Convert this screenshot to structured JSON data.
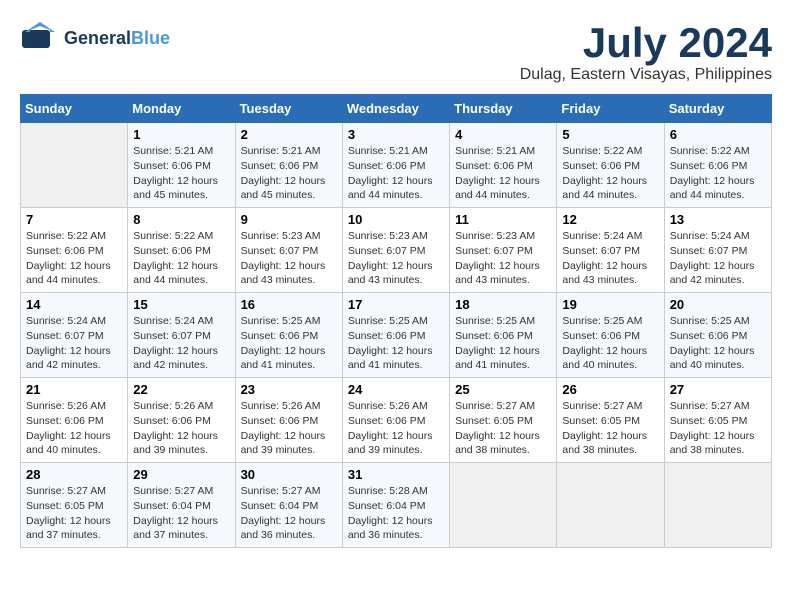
{
  "header": {
    "logo_line1": "General",
    "logo_line2": "Blue",
    "month_year": "July 2024",
    "location": "Dulag, Eastern Visayas, Philippines"
  },
  "days_of_week": [
    "Sunday",
    "Monday",
    "Tuesday",
    "Wednesday",
    "Thursday",
    "Friday",
    "Saturday"
  ],
  "weeks": [
    [
      {
        "day": "",
        "sunrise": "",
        "sunset": "",
        "daylight": ""
      },
      {
        "day": "1",
        "sunrise": "Sunrise: 5:21 AM",
        "sunset": "Sunset: 6:06 PM",
        "daylight": "Daylight: 12 hours and 45 minutes."
      },
      {
        "day": "2",
        "sunrise": "Sunrise: 5:21 AM",
        "sunset": "Sunset: 6:06 PM",
        "daylight": "Daylight: 12 hours and 45 minutes."
      },
      {
        "day": "3",
        "sunrise": "Sunrise: 5:21 AM",
        "sunset": "Sunset: 6:06 PM",
        "daylight": "Daylight: 12 hours and 44 minutes."
      },
      {
        "day": "4",
        "sunrise": "Sunrise: 5:21 AM",
        "sunset": "Sunset: 6:06 PM",
        "daylight": "Daylight: 12 hours and 44 minutes."
      },
      {
        "day": "5",
        "sunrise": "Sunrise: 5:22 AM",
        "sunset": "Sunset: 6:06 PM",
        "daylight": "Daylight: 12 hours and 44 minutes."
      },
      {
        "day": "6",
        "sunrise": "Sunrise: 5:22 AM",
        "sunset": "Sunset: 6:06 PM",
        "daylight": "Daylight: 12 hours and 44 minutes."
      }
    ],
    [
      {
        "day": "7",
        "sunrise": "Sunrise: 5:22 AM",
        "sunset": "Sunset: 6:06 PM",
        "daylight": "Daylight: 12 hours and 44 minutes."
      },
      {
        "day": "8",
        "sunrise": "Sunrise: 5:22 AM",
        "sunset": "Sunset: 6:06 PM",
        "daylight": "Daylight: 12 hours and 44 minutes."
      },
      {
        "day": "9",
        "sunrise": "Sunrise: 5:23 AM",
        "sunset": "Sunset: 6:07 PM",
        "daylight": "Daylight: 12 hours and 43 minutes."
      },
      {
        "day": "10",
        "sunrise": "Sunrise: 5:23 AM",
        "sunset": "Sunset: 6:07 PM",
        "daylight": "Daylight: 12 hours and 43 minutes."
      },
      {
        "day": "11",
        "sunrise": "Sunrise: 5:23 AM",
        "sunset": "Sunset: 6:07 PM",
        "daylight": "Daylight: 12 hours and 43 minutes."
      },
      {
        "day": "12",
        "sunrise": "Sunrise: 5:24 AM",
        "sunset": "Sunset: 6:07 PM",
        "daylight": "Daylight: 12 hours and 43 minutes."
      },
      {
        "day": "13",
        "sunrise": "Sunrise: 5:24 AM",
        "sunset": "Sunset: 6:07 PM",
        "daylight": "Daylight: 12 hours and 42 minutes."
      }
    ],
    [
      {
        "day": "14",
        "sunrise": "Sunrise: 5:24 AM",
        "sunset": "Sunset: 6:07 PM",
        "daylight": "Daylight: 12 hours and 42 minutes."
      },
      {
        "day": "15",
        "sunrise": "Sunrise: 5:24 AM",
        "sunset": "Sunset: 6:07 PM",
        "daylight": "Daylight: 12 hours and 42 minutes."
      },
      {
        "day": "16",
        "sunrise": "Sunrise: 5:25 AM",
        "sunset": "Sunset: 6:06 PM",
        "daylight": "Daylight: 12 hours and 41 minutes."
      },
      {
        "day": "17",
        "sunrise": "Sunrise: 5:25 AM",
        "sunset": "Sunset: 6:06 PM",
        "daylight": "Daylight: 12 hours and 41 minutes."
      },
      {
        "day": "18",
        "sunrise": "Sunrise: 5:25 AM",
        "sunset": "Sunset: 6:06 PM",
        "daylight": "Daylight: 12 hours and 41 minutes."
      },
      {
        "day": "19",
        "sunrise": "Sunrise: 5:25 AM",
        "sunset": "Sunset: 6:06 PM",
        "daylight": "Daylight: 12 hours and 40 minutes."
      },
      {
        "day": "20",
        "sunrise": "Sunrise: 5:25 AM",
        "sunset": "Sunset: 6:06 PM",
        "daylight": "Daylight: 12 hours and 40 minutes."
      }
    ],
    [
      {
        "day": "21",
        "sunrise": "Sunrise: 5:26 AM",
        "sunset": "Sunset: 6:06 PM",
        "daylight": "Daylight: 12 hours and 40 minutes."
      },
      {
        "day": "22",
        "sunrise": "Sunrise: 5:26 AM",
        "sunset": "Sunset: 6:06 PM",
        "daylight": "Daylight: 12 hours and 39 minutes."
      },
      {
        "day": "23",
        "sunrise": "Sunrise: 5:26 AM",
        "sunset": "Sunset: 6:06 PM",
        "daylight": "Daylight: 12 hours and 39 minutes."
      },
      {
        "day": "24",
        "sunrise": "Sunrise: 5:26 AM",
        "sunset": "Sunset: 6:06 PM",
        "daylight": "Daylight: 12 hours and 39 minutes."
      },
      {
        "day": "25",
        "sunrise": "Sunrise: 5:27 AM",
        "sunset": "Sunset: 6:05 PM",
        "daylight": "Daylight: 12 hours and 38 minutes."
      },
      {
        "day": "26",
        "sunrise": "Sunrise: 5:27 AM",
        "sunset": "Sunset: 6:05 PM",
        "daylight": "Daylight: 12 hours and 38 minutes."
      },
      {
        "day": "27",
        "sunrise": "Sunrise: 5:27 AM",
        "sunset": "Sunset: 6:05 PM",
        "daylight": "Daylight: 12 hours and 38 minutes."
      }
    ],
    [
      {
        "day": "28",
        "sunrise": "Sunrise: 5:27 AM",
        "sunset": "Sunset: 6:05 PM",
        "daylight": "Daylight: 12 hours and 37 minutes."
      },
      {
        "day": "29",
        "sunrise": "Sunrise: 5:27 AM",
        "sunset": "Sunset: 6:04 PM",
        "daylight": "Daylight: 12 hours and 37 minutes."
      },
      {
        "day": "30",
        "sunrise": "Sunrise: 5:27 AM",
        "sunset": "Sunset: 6:04 PM",
        "daylight": "Daylight: 12 hours and 36 minutes."
      },
      {
        "day": "31",
        "sunrise": "Sunrise: 5:28 AM",
        "sunset": "Sunset: 6:04 PM",
        "daylight": "Daylight: 12 hours and 36 minutes."
      },
      {
        "day": "",
        "sunrise": "",
        "sunset": "",
        "daylight": ""
      },
      {
        "day": "",
        "sunrise": "",
        "sunset": "",
        "daylight": ""
      },
      {
        "day": "",
        "sunrise": "",
        "sunset": "",
        "daylight": ""
      }
    ]
  ]
}
